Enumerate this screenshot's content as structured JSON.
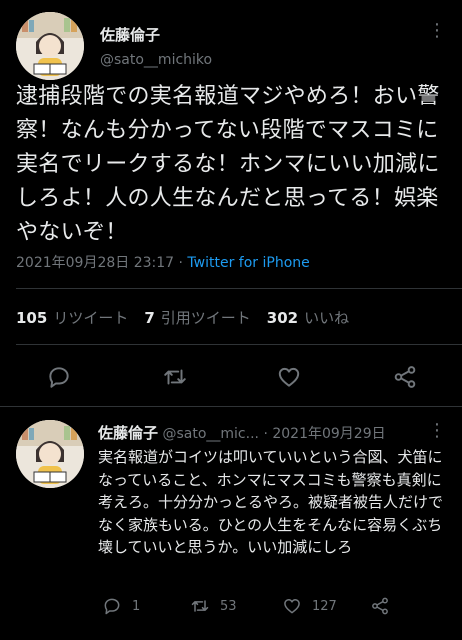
{
  "main_tweet": {
    "display_name": "佐藤倫子",
    "handle": "@sato__michiko",
    "text": "逮捕段階での実名報道マジやめろ！おい警察！なんも分かってない段階でマスコミに実名でリークするな！ホンマにいい加減にしろよ！人の人生なんだと思ってる！娯楽やないぞ！",
    "timestamp": "2021年09月28日 23:17",
    "separator": "·",
    "source": "Twitter for iPhone",
    "stats": {
      "retweets_count": "105",
      "retweets_label": "リツイート",
      "quotes_count": "7",
      "quotes_label": "引用ツイート",
      "likes_count": "302",
      "likes_label": "いいね"
    }
  },
  "reply_tweet": {
    "display_name": "佐藤倫子",
    "handle": "@sato__mic...",
    "separator": "·",
    "date": "2021年09月29日",
    "text": "実名報道がコイツは叩いていいという合図、犬笛になっていること、ホンマにマスコミも警察も真剣に考えろ。十分分かっとるやろ。被疑者被告人だけでなく家族もいる。ひとの人生をそんなに容易くぶち壊していいと思うか。いい加減にしろ",
    "reply_count": "1",
    "retweet_count": "53",
    "like_count": "127"
  },
  "colors": {
    "background": "#000000",
    "text": "#e7e9ea",
    "secondary": "#71767b",
    "link": "#1d9bf0",
    "divider": "#2f3336"
  },
  "icons": [
    "avatar-illustration",
    "more-icon",
    "reply-icon",
    "retweet-icon",
    "like-icon",
    "share-icon"
  ]
}
